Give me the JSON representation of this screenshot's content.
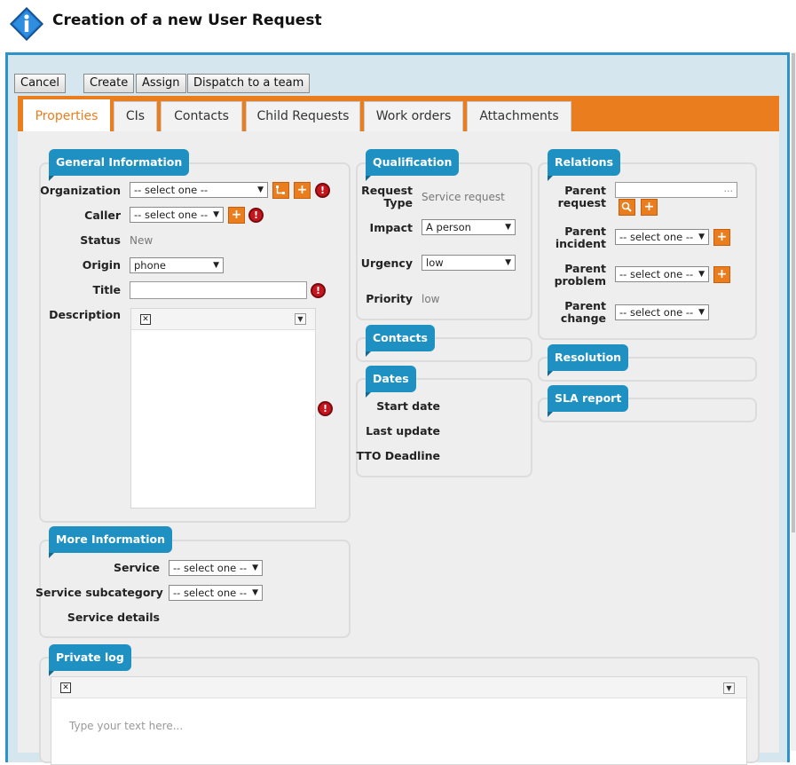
{
  "header": {
    "title": "Creation of a new User Request"
  },
  "toolbar": {
    "cancel": "Cancel",
    "create": "Create",
    "assign": "Assign",
    "dispatch": "Dispatch to a team"
  },
  "tabs": [
    "Properties",
    "CIs",
    "Contacts",
    "Child Requests",
    "Work orders",
    "Attachments"
  ],
  "general": {
    "legend": "General Information",
    "organization_label": "Organization",
    "organization_value": "-- select one --",
    "caller_label": "Caller",
    "caller_value": "-- select one --",
    "status_label": "Status",
    "status_value": "New",
    "origin_label": "Origin",
    "origin_value": "phone",
    "title_label": "Title",
    "title_value": "",
    "description_label": "Description"
  },
  "more": {
    "legend": "More Information",
    "service_label": "Service",
    "service_value": "-- select one --",
    "subcategory_label": "Service subcategory",
    "subcategory_value": "-- select one --",
    "details_label": "Service details"
  },
  "qualification": {
    "legend": "Qualification",
    "request_type_label1": "Request",
    "request_type_label2": "Type",
    "request_type_value": "Service request",
    "impact_label": "Impact",
    "impact_value": "A person",
    "urgency_label": "Urgency",
    "urgency_value": "low",
    "priority_label": "Priority",
    "priority_value": "low"
  },
  "contacts": {
    "legend": "Contacts"
  },
  "dates": {
    "legend": "Dates",
    "start_label": "Start date",
    "update_label": "Last update",
    "tto_label": "TTO Deadline"
  },
  "relations": {
    "legend": "Relations",
    "parent_request_1": "Parent",
    "parent_request_2": "request",
    "parent_request_value": "...",
    "parent_incident_1": "Parent",
    "parent_incident_2": "incident",
    "parent_incident_value": "-- select one --",
    "parent_problem_1": "Parent",
    "parent_problem_2": "problem",
    "parent_problem_value": "-- select one --",
    "parent_change_1": "Parent",
    "parent_change_2": "change",
    "parent_change_value": "-- select one --"
  },
  "resolution": {
    "legend": "Resolution"
  },
  "sla": {
    "legend": "SLA report"
  },
  "private_log": {
    "legend": "Private log",
    "placeholder": "Type your text here..."
  },
  "colors": {
    "accent": "#ea7d1e",
    "legend_blue": "#1f90c2",
    "frame_border": "#2b93c7",
    "mandatory_red": "#c4161c"
  }
}
